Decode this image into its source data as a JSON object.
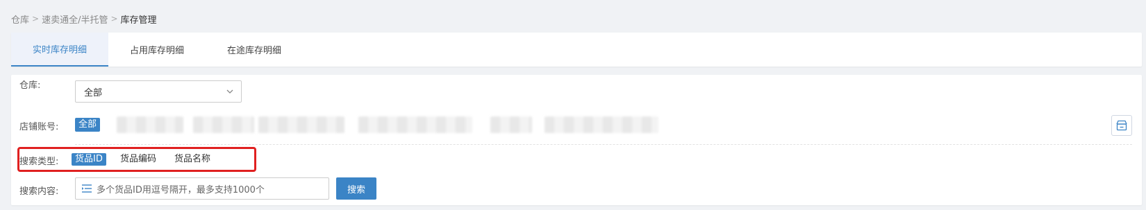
{
  "breadcrumb": {
    "items": [
      "仓库",
      "速卖通全/半托管",
      "库存管理"
    ],
    "separator": ">"
  },
  "tabs": [
    {
      "label": "实时库存明细",
      "active": true
    },
    {
      "label": "占用库存明细",
      "active": false
    },
    {
      "label": "在途库存明细",
      "active": false
    }
  ],
  "filters": {
    "warehouse_label": "仓库:",
    "warehouse_value": "全部",
    "shop_label": "店铺账号:",
    "shop_all_tag": "全部",
    "search_type_label": "搜索类型:",
    "search_types": [
      "货品ID",
      "货品编码",
      "货品名称"
    ],
    "search_type_active": "货品ID",
    "search_content_label": "搜索内容:",
    "search_placeholder": "多个货品ID用逗号隔开，最多支持1000个",
    "search_button": "搜索"
  },
  "colors": {
    "accent": "#3b84c6",
    "highlight": "#e02020"
  },
  "icons": {
    "breadcrumb_separator": "chevron-right-icon",
    "select_arrow": "chevron-down-icon",
    "shop_button": "store-icon",
    "search_field": "list-icon"
  }
}
